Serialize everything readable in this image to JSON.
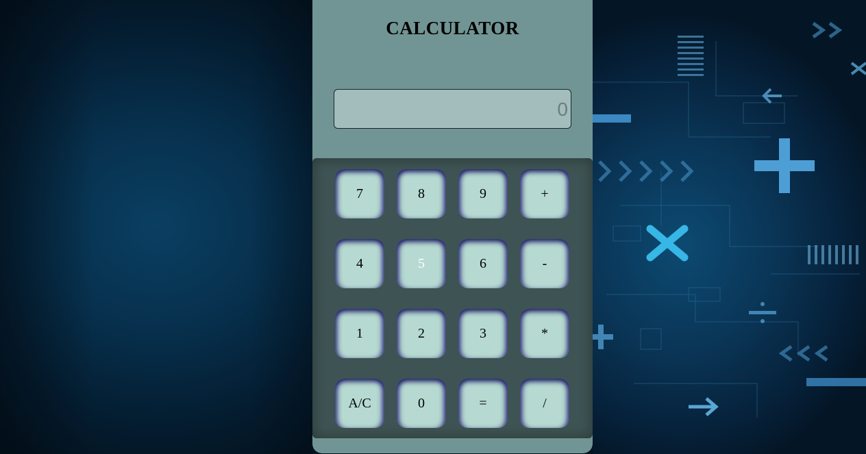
{
  "app": {
    "title": "CALCULATOR"
  },
  "display": {
    "value": "0"
  },
  "keys": {
    "k7": "7",
    "k8": "8",
    "k9": "9",
    "plus": "+",
    "k4": "4",
    "k5": "5",
    "k6": "6",
    "minus": "-",
    "k1": "1",
    "k2": "2",
    "k3": "3",
    "multiply": "*",
    "clear": "A/C",
    "k0": "0",
    "equals": "=",
    "divide": "/"
  },
  "colors": {
    "panel": "#719594",
    "keypad": "#3e5353",
    "key": "#b6dad1",
    "key_shadow": "#1d1c64",
    "display": "#a3bdbd"
  },
  "background": {
    "icons": [
      "plus-icon",
      "times-icon",
      "divide-icon",
      "plus-icon",
      "minus-icon",
      "arrow-right-icon"
    ]
  }
}
